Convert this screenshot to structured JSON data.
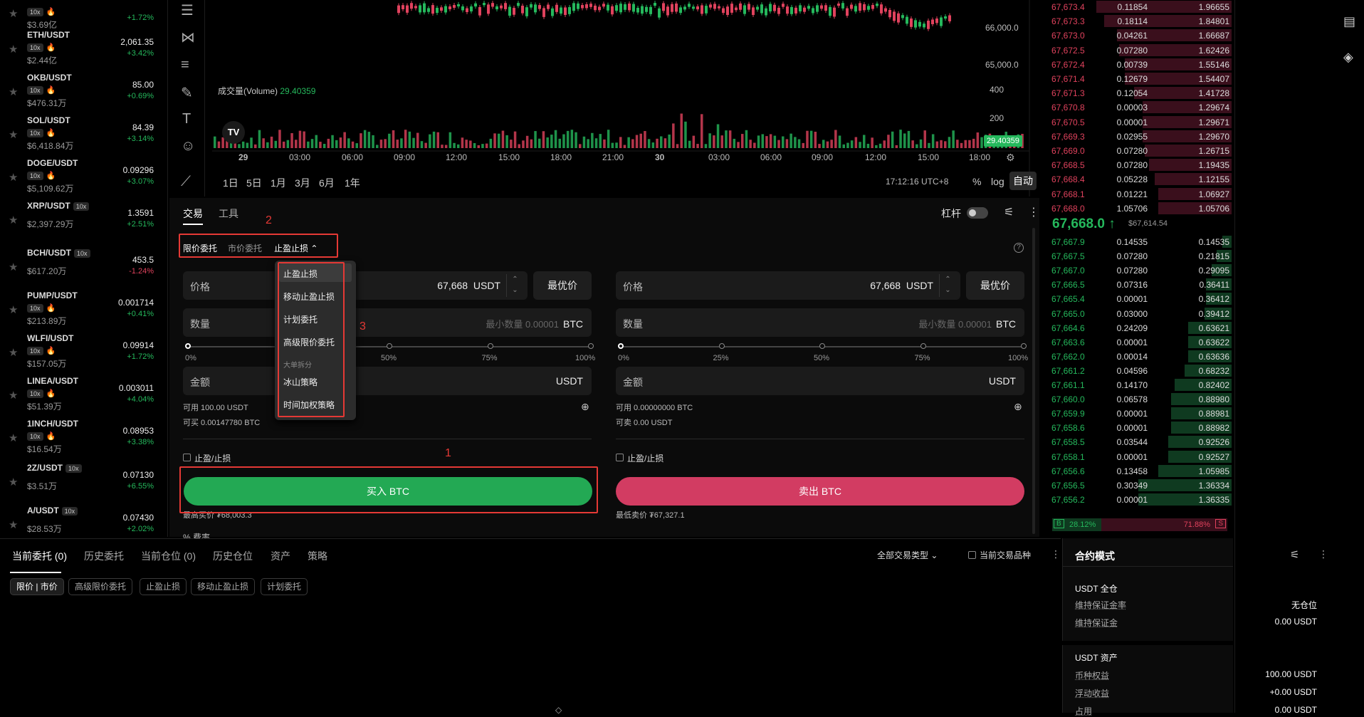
{
  "symbols": [
    {
      "name": "",
      "leverage": "10x",
      "volume": "$3.69亿",
      "price": "",
      "change": "+1.72%",
      "dir": "up"
    },
    {
      "name": "ETH/USDT",
      "leverage": "10x",
      "volume": "$2.44亿",
      "price": "2,061.35",
      "change": "+3.42%",
      "dir": "up"
    },
    {
      "name": "OKB/USDT",
      "leverage": "10x",
      "volume": "$476.31万",
      "price": "85.00",
      "change": "+0.69%",
      "dir": "up"
    },
    {
      "name": "SOL/USDT",
      "leverage": "10x",
      "volume": "$6,418.84万",
      "price": "84.39",
      "change": "+3.14%",
      "dir": "up"
    },
    {
      "name": "DOGE/USDT",
      "leverage": "10x",
      "volume": "$5,109.62万",
      "price": "0.09296",
      "change": "+3.07%",
      "dir": "up"
    },
    {
      "name": "XRP/USDT",
      "leverage": "10x",
      "volume": "$2,397.29万",
      "price": "1.3591",
      "change": "+2.51%",
      "dir": "up"
    },
    {
      "name": "BCH/USDT",
      "leverage": "10x",
      "volume": "$617.20万",
      "price": "453.5",
      "change": "-1.24%",
      "dir": "down"
    },
    {
      "name": "PUMP/USDT",
      "leverage": "10x",
      "volume": "$213.89万",
      "price": "0.001714",
      "change": "+0.41%",
      "dir": "up"
    },
    {
      "name": "WLFI/USDT",
      "leverage": "10x",
      "volume": "$157.05万",
      "price": "0.09914",
      "change": "+1.72%",
      "dir": "up"
    },
    {
      "name": "LINEA/USDT",
      "leverage": "10x",
      "volume": "$51.39万",
      "price": "0.003011",
      "change": "+4.04%",
      "dir": "up"
    },
    {
      "name": "1INCH/USDT",
      "leverage": "10x",
      "volume": "$16.54万",
      "price": "0.08953",
      "change": "+3.38%",
      "dir": "up"
    },
    {
      "name": "2Z/USDT",
      "leverage": "10x",
      "volume": "$3.51万",
      "price": "0.07130",
      "change": "+6.55%",
      "dir": "up"
    },
    {
      "name": "A/USDT",
      "leverage": "10x",
      "volume": "$28.53万",
      "price": "0.07430",
      "change": "+2.02%",
      "dir": "up"
    }
  ],
  "chart": {
    "price_ticks": [
      "66,000.0",
      "65,000.0"
    ],
    "volume_label": "成交量(Volume)",
    "volume_value": "29.40359",
    "volume_ticks": [
      "400",
      "200"
    ],
    "volume_badge": "29.40359",
    "time_ticks": [
      "29",
      "03:00",
      "06:00",
      "09:00",
      "12:00",
      "15:00",
      "18:00",
      "21:00",
      "30",
      "03:00",
      "06:00",
      "09:00",
      "12:00",
      "15:00",
      "18:00"
    ],
    "timeframes": [
      "1日",
      "5日",
      "1月",
      "3月",
      "6月",
      "1年"
    ],
    "clock": "17:12:16 UTC+8",
    "opt_pct": "%",
    "opt_log": "log",
    "opt_auto": "自动"
  },
  "trade": {
    "tab_trade": "交易",
    "tab_tools": "工具",
    "leverage_label": "杠杆",
    "order_types": [
      "限价委托",
      "市价委托",
      "止盈止损"
    ],
    "dropdown": {
      "items": [
        "止盈止损",
        "移动止盈止损",
        "计划委托",
        "高级限价委托"
      ],
      "section": "大单拆分",
      "items2": [
        "冰山策略",
        "时间加权策略"
      ]
    },
    "buy": {
      "price_label": "价格",
      "price_value": "67,668",
      "price_unit": "USDT",
      "best": "最优价",
      "qty_label": "数量",
      "qty_placeholder": "最小数量 0.00001",
      "qty_unit": "BTC",
      "pcts": [
        "0%",
        "25%",
        "50%",
        "75%",
        "100%"
      ],
      "amount_label": "金额",
      "amount_unit": "USDT",
      "avail": "可用 100.00 USDT",
      "can": "可买 0.00147780 BTC",
      "tpsl": "止盈/止损",
      "button": "买入 BTC",
      "est": "最高买价 ₮68,003.3"
    },
    "sell": {
      "price_label": "价格",
      "price_value": "67,668",
      "price_unit": "USDT",
      "best": "最优价",
      "qty_label": "数量",
      "qty_placeholder": "最小数量 0.00001",
      "qty_unit": "BTC",
      "pcts": [
        "0%",
        "25%",
        "50%",
        "75%",
        "100%"
      ],
      "amount_label": "金额",
      "amount_unit": "USDT",
      "avail": "可用 0.00000000 BTC",
      "can": "可卖 0.00 USDT",
      "tpsl": "止盈/止损",
      "button": "卖出 BTC",
      "est": "最低卖价 ₮67,327.1"
    },
    "fee": "% 费率",
    "annotations": [
      "1",
      "2",
      "3"
    ]
  },
  "orderbook": {
    "asks": [
      {
        "p": "67,673.4",
        "a": "0.11854",
        "t": "1.96655",
        "d": 1.0
      },
      {
        "p": "67,673.3",
        "a": "0.18114",
        "t": "1.84801",
        "d": 0.94
      },
      {
        "p": "67,673.0",
        "a": "0.04261",
        "t": "1.66687",
        "d": 0.85
      },
      {
        "p": "67,672.5",
        "a": "0.07280",
        "t": "1.62426",
        "d": 0.83
      },
      {
        "p": "67,672.4",
        "a": "0.00739",
        "t": "1.55146",
        "d": 0.79
      },
      {
        "p": "67,671.4",
        "a": "0.12679",
        "t": "1.54407",
        "d": 0.79
      },
      {
        "p": "67,671.3",
        "a": "0.12054",
        "t": "1.41728",
        "d": 0.72
      },
      {
        "p": "67,670.8",
        "a": "0.00003",
        "t": "1.29674",
        "d": 0.66
      },
      {
        "p": "67,670.5",
        "a": "0.00001",
        "t": "1.29671",
        "d": 0.66
      },
      {
        "p": "67,669.3",
        "a": "0.02955",
        "t": "1.29670",
        "d": 0.66
      },
      {
        "p": "67,669.0",
        "a": "0.07280",
        "t": "1.26715",
        "d": 0.64
      },
      {
        "p": "67,668.5",
        "a": "0.07280",
        "t": "1.19435",
        "d": 0.61
      },
      {
        "p": "67,668.4",
        "a": "0.05228",
        "t": "1.12155",
        "d": 0.57
      },
      {
        "p": "67,668.1",
        "a": "0.01221",
        "t": "1.06927",
        "d": 0.54
      },
      {
        "p": "67,668.0",
        "a": "1.05706",
        "t": "1.05706",
        "d": 0.54
      }
    ],
    "mid": "67,668.0 ↑",
    "mark": "$67,614.54",
    "bids": [
      {
        "p": "67,667.9",
        "a": "0.14535",
        "t": "0.14535",
        "d": 0.07
      },
      {
        "p": "67,667.5",
        "a": "0.07280",
        "t": "0.21815",
        "d": 0.11
      },
      {
        "p": "67,667.0",
        "a": "0.07280",
        "t": "0.29095",
        "d": 0.15
      },
      {
        "p": "67,666.5",
        "a": "0.07316",
        "t": "0.36411",
        "d": 0.19
      },
      {
        "p": "67,665.4",
        "a": "0.00001",
        "t": "0.36412",
        "d": 0.19
      },
      {
        "p": "67,665.0",
        "a": "0.03000",
        "t": "0.39412",
        "d": 0.2
      },
      {
        "p": "67,664.6",
        "a": "0.24209",
        "t": "0.63621",
        "d": 0.32
      },
      {
        "p": "67,663.6",
        "a": "0.00001",
        "t": "0.63622",
        "d": 0.32
      },
      {
        "p": "67,662.0",
        "a": "0.00014",
        "t": "0.63636",
        "d": 0.32
      },
      {
        "p": "67,661.2",
        "a": "0.04596",
        "t": "0.68232",
        "d": 0.35
      },
      {
        "p": "67,661.1",
        "a": "0.14170",
        "t": "0.82402",
        "d": 0.42
      },
      {
        "p": "67,660.0",
        "a": "0.06578",
        "t": "0.88980",
        "d": 0.45
      },
      {
        "p": "67,659.9",
        "a": "0.00001",
        "t": "0.88981",
        "d": 0.45
      },
      {
        "p": "67,658.6",
        "a": "0.00001",
        "t": "0.88982",
        "d": 0.45
      },
      {
        "p": "67,658.5",
        "a": "0.03544",
        "t": "0.92526",
        "d": 0.47
      },
      {
        "p": "67,658.1",
        "a": "0.00001",
        "t": "0.92527",
        "d": 0.47
      },
      {
        "p": "67,656.6",
        "a": "0.13458",
        "t": "1.05985",
        "d": 0.54
      },
      {
        "p": "67,656.5",
        "a": "0.30349",
        "t": "1.36334",
        "d": 0.69
      },
      {
        "p": "67,656.2",
        "a": "0.00001",
        "t": "1.36335",
        "d": 0.69
      }
    ],
    "b_label": "B",
    "b_pct": "28.12%",
    "s_label": "S",
    "s_pct": "71.88%",
    "buy_ratio": 0.2812
  },
  "bottom": {
    "tabs": [
      "当前委托 (0)",
      "历史委托",
      "当前仓位 (0)",
      "历史仓位",
      "资产",
      "策略"
    ],
    "filter": "全部交易类型",
    "current_pair": "当前交易品种",
    "chips": [
      "限价 | 市价",
      "高级限价委托",
      "止盈止损",
      "移动止盈止损",
      "计划委托"
    ]
  },
  "account": {
    "title": "合约模式",
    "sec1": "USDT 全仓",
    "rows1": [
      {
        "k": "维持保证金率",
        "v": "无仓位"
      },
      {
        "k": "维持保证金",
        "v": "0.00 USDT"
      }
    ],
    "sec2": "USDT 资产",
    "rows2": [
      {
        "k": "币种权益",
        "v": "100.00 USDT"
      },
      {
        "k": "浮动收益",
        "v": "+0.00 USDT"
      },
      {
        "k": "占用",
        "v": "0.00 USDT"
      }
    ]
  },
  "colors": {
    "up": "#25b85c",
    "down": "#e0425d",
    "accent_buy": "#23a954",
    "accent_sell": "#d23c62",
    "annotation": "#e53935"
  }
}
